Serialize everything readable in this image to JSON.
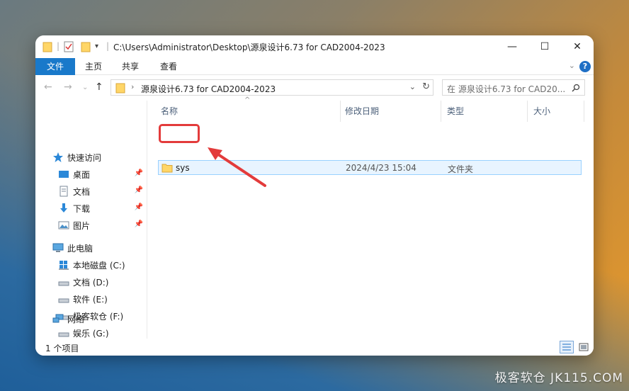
{
  "window": {
    "title": "C:\\Users\\Administrator\\Desktop\\源泉设计6.73 for CAD2004-2023",
    "minimize": "—",
    "maximize": "☐",
    "close": "✕"
  },
  "ribbon": {
    "tabs": [
      "文件",
      "主页",
      "共享",
      "查看"
    ],
    "help": "?"
  },
  "address": {
    "path": "源泉设计6.73 for CAD2004-2023",
    "search_placeholder": "在 源泉设计6.73 for CAD20..."
  },
  "nav": {
    "quick_access": "快速访问",
    "items": [
      {
        "label": "桌面",
        "pinned": true
      },
      {
        "label": "文档",
        "pinned": true
      },
      {
        "label": "下载",
        "pinned": true
      },
      {
        "label": "图片",
        "pinned": true
      }
    ],
    "this_pc": "此电脑",
    "drives": [
      "本地磁盘 (C:)",
      "文档 (D:)",
      "软件 (E:)",
      "极客软仓 (F:)",
      "娱乐 (G:)"
    ],
    "network": "网络"
  },
  "columns": [
    "名称",
    "修改日期",
    "类型",
    "大小"
  ],
  "files": [
    {
      "name": "sys",
      "modified": "2024/4/23 15:04",
      "type": "文件夹",
      "size": ""
    }
  ],
  "status": {
    "count": "1 个项目"
  },
  "watermark": "极客软仓 JK115.COM",
  "colors": {
    "accent": "#1979ca",
    "selection": "#e8f4ff",
    "highlight": "#e33b3b"
  }
}
